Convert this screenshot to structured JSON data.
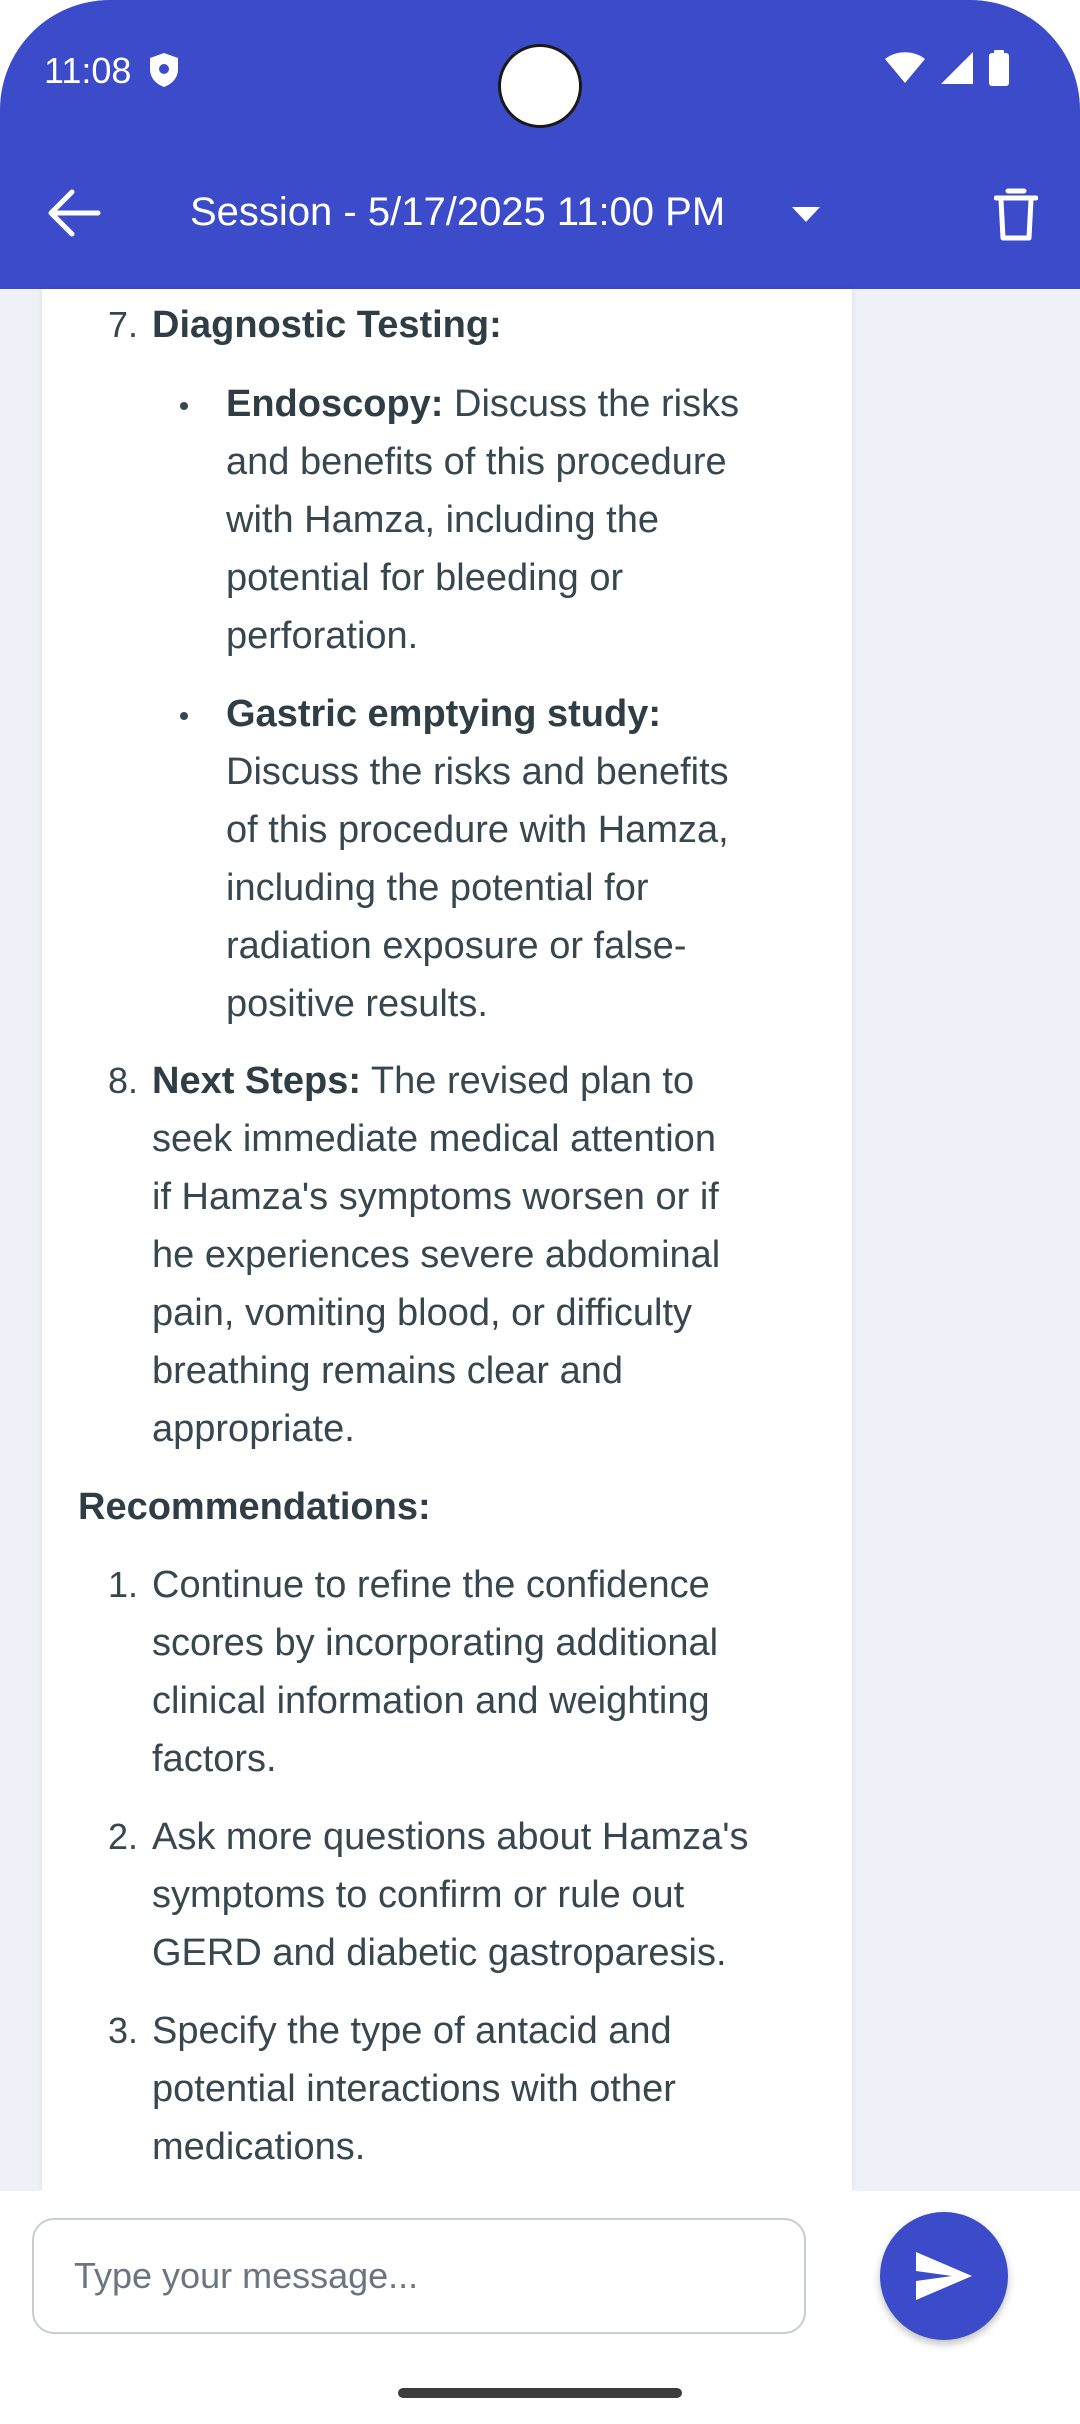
{
  "status_bar": {
    "time": "11:08"
  },
  "app_bar": {
    "title": "Session - 5/17/2025 11:00 PM"
  },
  "content": {
    "item7": {
      "number": "7.",
      "title": "Diagnostic Testing:",
      "bullets": [
        {
          "label": "Endoscopy:",
          "lines": [
            " Discuss the risks",
            "and benefits of this procedure",
            "with Hamza, including the",
            "potential for bleeding or",
            "perforation."
          ]
        },
        {
          "label": "Gastric emptying study:",
          "lines": [
            "Discuss the risks and benefits",
            "of this procedure with Hamza,",
            "including the potential for",
            "radiation exposure or false-",
            "positive results."
          ]
        }
      ]
    },
    "item8": {
      "number": "8.",
      "label": "Next Steps:",
      "lines": [
        " The revised plan to",
        "seek immediate medical attention",
        "if Hamza's symptoms worsen or if",
        "he experiences severe abdominal",
        "pain, vomiting blood, or difficulty",
        "breathing remains clear and",
        "appropriate."
      ]
    },
    "recommendations_heading": "Recommendations:",
    "recommendations": [
      {
        "number": "1.",
        "lines": [
          "Continue to refine the confidence",
          "scores by incorporating additional",
          "clinical information and weighting",
          "factors."
        ]
      },
      {
        "number": "2.",
        "lines": [
          "Ask more questions about Hamza's",
          "symptoms to confirm or rule out",
          "GERD and diabetic gastroparesis."
        ]
      },
      {
        "number": "3.",
        "lines": [
          "Specify the type of antacid and",
          "potential interactions with other",
          "medications."
        ]
      }
    ]
  },
  "input": {
    "placeholder": "Type your message..."
  },
  "colors": {
    "primary": "#3b4bc9",
    "background": "#eef1f7",
    "text": "#37474f"
  },
  "icons": [
    "back-arrow-icon",
    "dropdown-caret-icon",
    "trash-icon",
    "send-icon",
    "wifi-icon",
    "signal-icon",
    "battery-icon",
    "shield-icon"
  ]
}
